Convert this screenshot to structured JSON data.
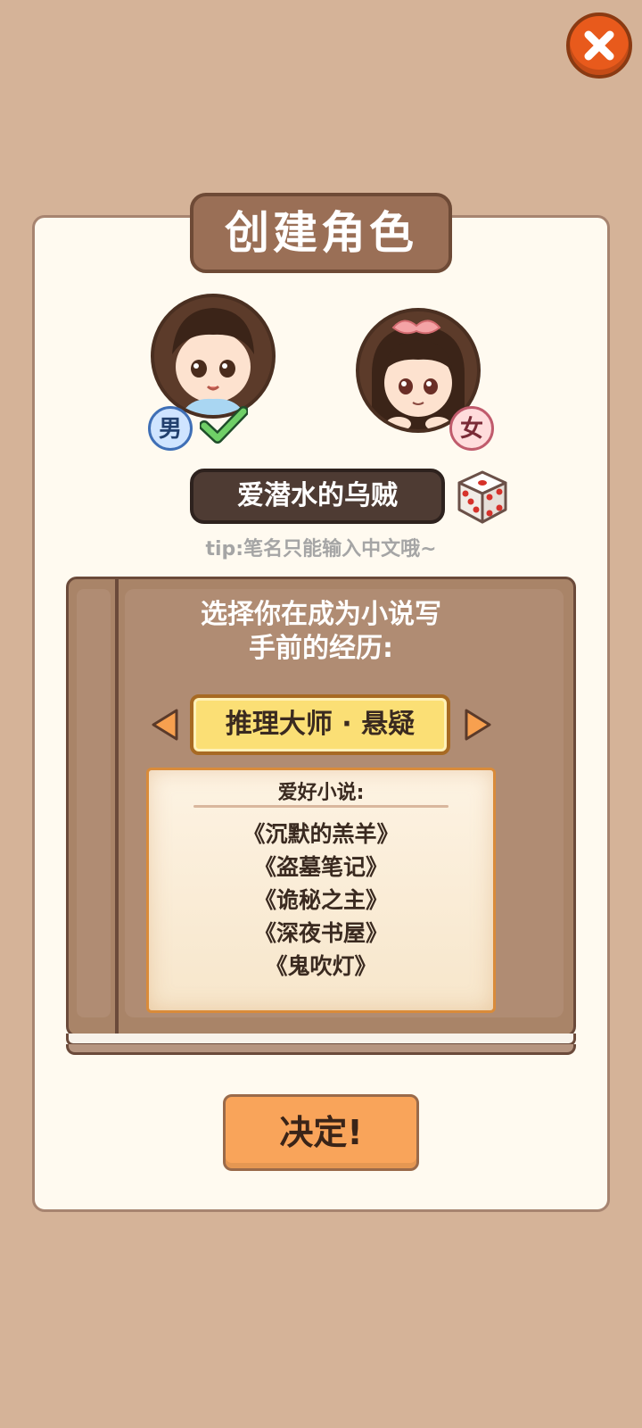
{
  "header": {
    "title": "创建角色"
  },
  "gender": {
    "male_label": "男",
    "female_label": "女",
    "selected": "男"
  },
  "pen_name": {
    "value": "爱潜水的乌贼",
    "tip": "tip:笔名只能输入中文哦~"
  },
  "experience": {
    "question_line1": "选择你在成为小说写",
    "question_line2": "手前的经历:",
    "current": "推理大师 · 悬疑",
    "favorites_heading": "爱好小说:",
    "novels": [
      "《沉默的羔羊》",
      "《盗墓笔记》",
      "《诡秘之主》",
      "《深夜书屋》",
      "《鬼吹灯》"
    ]
  },
  "actions": {
    "confirm_label": "决定!"
  },
  "icons": {
    "close": "close-icon",
    "dice": "dice-icon",
    "check": "check-icon",
    "prev": "arrow-left-icon",
    "next": "arrow-right-icon"
  },
  "colors": {
    "background": "#d5b398",
    "close_button": "#e85a1c",
    "title_plate": "#9a6f56",
    "confirm_button": "#f9a45a",
    "experience_plate": "#fbdf75"
  }
}
